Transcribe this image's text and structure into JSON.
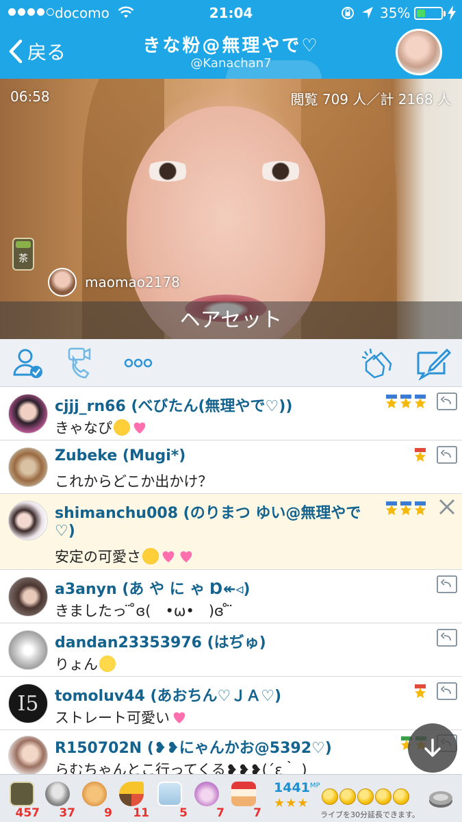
{
  "status_bar": {
    "carrier": "docomo",
    "time": "21:04",
    "battery": "35%",
    "battery_level": 0.35
  },
  "nav": {
    "back_label": "戻る",
    "title": "きな粉@無理やで♡",
    "subtitle": "@Kanachan7"
  },
  "video": {
    "elapsed": "06:58",
    "viewers": "閲覧 709 人／計 2168 人",
    "tea_label": "茶",
    "viewer_name": "maomao2178",
    "caption": "ヘアセット"
  },
  "actions": {
    "icons": [
      "user-check-icon",
      "call-icon",
      "more-icon",
      "clap-icon",
      "compose-icon"
    ]
  },
  "comments": [
    {
      "name": "cjjj_rn66 (べびたん(無理やで♡))",
      "message": "きゃなぴ",
      "emoji": [
        "love",
        "heart"
      ],
      "badges": [
        "blue",
        "blue",
        "blue"
      ],
      "action": "reply-icon"
    },
    {
      "name": "Zubeke (Mugi*)",
      "message": "これからどこか出かけ？",
      "emoji": [],
      "badges": [
        "red"
      ],
      "action": "reply-icon"
    },
    {
      "name": "shimanchu008 (のりまつ ゆい@無理やで",
      "name_line2": "♡)",
      "message": "安定の可愛さ",
      "emoji": [
        "love",
        "heart",
        "heart"
      ],
      "badges": [
        "blue",
        "blue",
        "blue"
      ],
      "action": "close-icon",
      "highlighted": true
    },
    {
      "name": "a3anyn (あ や に ゃ Ɒ↞◃)",
      "message": "きましたっ ̈ ̊ɞ(　•ω•　)ɞ ̊ ̈",
      "emoji": [],
      "badges": [],
      "action": "reply-icon"
    },
    {
      "name": "dandan23353976 (はぢゅ)",
      "message": "りょん",
      "emoji": [
        "neutral"
      ],
      "badges": [],
      "action": "reply-icon"
    },
    {
      "name": "tomoluv44 (あおちん♡ＪＡ♡)",
      "message": "ストレート可愛い",
      "emoji": [
        "heart"
      ],
      "badges": [
        "red"
      ],
      "action": "reply-icon"
    },
    {
      "name": "R150702N (❥❥にゃんかお@5392♡)",
      "message": "らむちゃんとこ行ってくる❥❥❥(´ε｀ )",
      "emoji": [],
      "badges": [
        "green",
        "green"
      ],
      "action": "reply-icon"
    }
  ],
  "gifts": [
    {
      "icon": "tea-icon",
      "count": "457"
    },
    {
      "icon": "coin-stack-icon",
      "count": "37"
    },
    {
      "icon": "clap-gift-icon",
      "count": "9"
    },
    {
      "icon": "party-popper-icon",
      "count": "11"
    },
    {
      "icon": "penguin-icon",
      "count": "5"
    },
    {
      "icon": "bear-icon",
      "count": "7"
    },
    {
      "icon": "cake-icon",
      "count": "7"
    }
  ],
  "points": {
    "value": "1441",
    "unit": "MP",
    "stars": "★★★",
    "extend_text": "ライブを30分延長できます。"
  },
  "colors": {
    "brand": "#1ea6e6",
    "username": "#13638e",
    "highlight_row": "#fdf7e4",
    "gift_count": "#e8322e"
  }
}
